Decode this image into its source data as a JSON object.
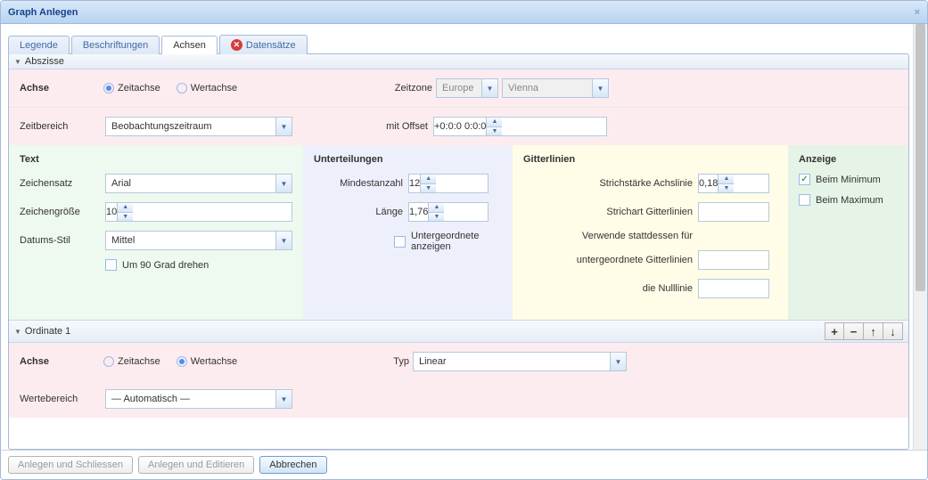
{
  "window": {
    "title": "Graph Anlegen"
  },
  "tabs": {
    "legende": "Legende",
    "beschriftungen": "Beschriftungen",
    "achsen": "Achsen",
    "datensaetze": "Datensätze"
  },
  "abszisse": {
    "header": "Abszisse",
    "achse_label": "Achse",
    "zeitachse": "Zeitachse",
    "wertachse": "Wertachse",
    "zeitbereich_label": "Zeitbereich",
    "zeitbereich_value": "Beobachtungszeitraum",
    "zeitzone_label": "Zeitzone",
    "zeitzone_region": "Europe",
    "zeitzone_city": "Vienna",
    "offset_label": "mit Offset",
    "offset_value": "+0:0:0 0:0:0",
    "text": {
      "title": "Text",
      "zeichensatz_label": "Zeichensatz",
      "zeichensatz_value": "Arial",
      "zeichengroesse_label": "Zeichengröße",
      "zeichengroesse_value": "10",
      "datumsstil_label": "Datums-Stil",
      "datumsstil_value": "Mittel",
      "rotate_label": "Um 90 Grad drehen"
    },
    "unterteilungen": {
      "title": "Unterteilungen",
      "mindestanzahl_label": "Mindestanzahl",
      "mindestanzahl_value": "12",
      "laenge_label": "Länge",
      "laenge_value": "1,76",
      "untergeordnete_label": "Untergeordnete anzeigen"
    },
    "gitter": {
      "title": "Gitterlinien",
      "strichstaerke_label": "Strichstärke Achslinie",
      "strichstaerke_value": "0,18",
      "strichart_label": "Strichart Gitterlinien",
      "strichart_value": "",
      "verwende_label": "Verwende stattdessen für",
      "untergeordnete_label": "untergeordnete Gitterlinien",
      "untergeordnete_value": "",
      "nulllinie_label": "die Nulllinie",
      "nulllinie_value": ""
    },
    "anzeige": {
      "title": "Anzeige",
      "beim_min": "Beim Minimum",
      "beim_max": "Beim Maximum"
    }
  },
  "ordinate": {
    "header": "Ordinate 1",
    "achse_label": "Achse",
    "zeitachse": "Zeitachse",
    "wertachse": "Wertachse",
    "typ_label": "Typ",
    "typ_value": "Linear",
    "wertebereich_label": "Wertebereich",
    "wertebereich_value": "— Automatisch —"
  },
  "buttons": {
    "anlegen_schliessen": "Anlegen und Schliessen",
    "anlegen_editieren": "Anlegen und Editieren",
    "abbrechen": "Abbrechen"
  }
}
